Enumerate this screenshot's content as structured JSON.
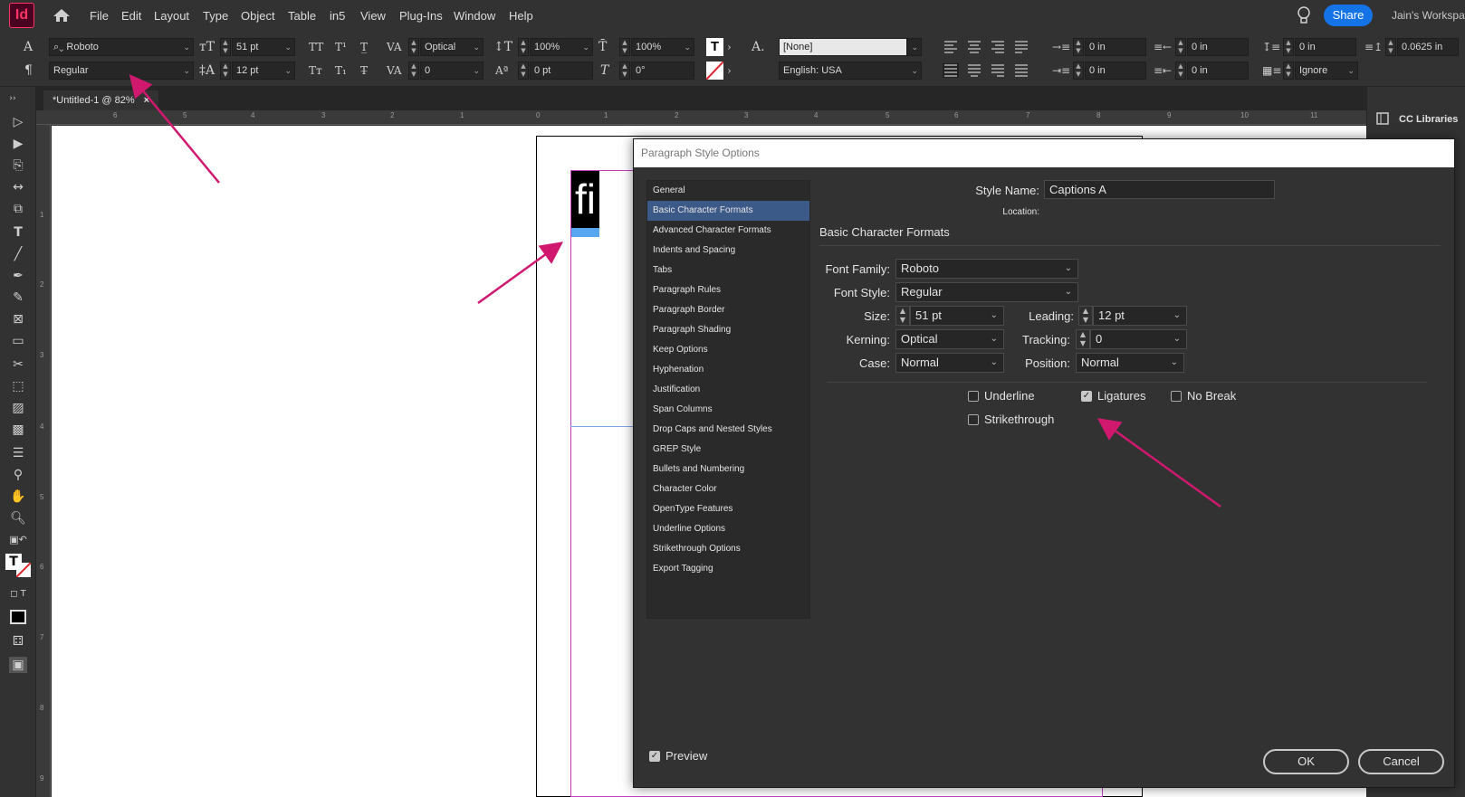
{
  "app": {
    "logo": "Id",
    "colors": {
      "accent": "#1473e6",
      "logo_bg": "#49021f",
      "logo_fg": "#ff3366",
      "annotation_arrow": "#d0186f",
      "selected_category": "#3c5a88"
    }
  },
  "menubar": {
    "items": [
      "File",
      "Edit",
      "Layout",
      "Type",
      "Object",
      "Table",
      "in5",
      "View",
      "Plug-Ins",
      "Window",
      "Help"
    ],
    "share_label": "Share",
    "workspace": "Jain's Workspace"
  },
  "control_panel": {
    "mode_char": "A",
    "mode_para": "¶",
    "font_family": "Roboto",
    "font_style": "Regular",
    "font_size": "51 pt",
    "leading": "12 pt",
    "kerning": "Optical",
    "tracking": "0",
    "vertical_scale": "100%",
    "horizontal_scale": "100%",
    "baseline_shift": "0 pt",
    "skew": "0°",
    "char_style": "[None]",
    "language": "English: USA",
    "left_indent": "0 in",
    "first_line_indent": "0 in",
    "right_indent": "0 in",
    "last_line_indent": "0 in",
    "space_before": "0 in",
    "space_after": "0.0625 in",
    "grid_align": "Ignore"
  },
  "document": {
    "tab_title": "*Untitled-1 @ 82%",
    "close_glyph": "×",
    "glyph_sample": "fi"
  },
  "rulers": {
    "h_ticks": [
      "6",
      "5",
      "4",
      "3",
      "2",
      "1",
      "0",
      "1",
      "2",
      "3",
      "4",
      "5",
      "6",
      "7",
      "8",
      "9",
      "10",
      "11"
    ],
    "v_ticks": [
      "1",
      "2",
      "3",
      "4",
      "5",
      "6",
      "7",
      "8",
      "9"
    ]
  },
  "right_panel": {
    "cc_libraries": "CC Libraries"
  },
  "dialog": {
    "title": "Paragraph Style Options",
    "categories": [
      "General",
      "Basic Character Formats",
      "Advanced Character Formats",
      "Indents and Spacing",
      "Tabs",
      "Paragraph Rules",
      "Paragraph Border",
      "Paragraph Shading",
      "Keep Options",
      "Hyphenation",
      "Justification",
      "Span Columns",
      "Drop Caps and Nested Styles",
      "GREP Style",
      "Bullets and Numbering",
      "Character Color",
      "OpenType Features",
      "Underline Options",
      "Strikethrough Options",
      "Export Tagging"
    ],
    "selected_category": "Basic Character Formats",
    "style_name_label": "Style Name:",
    "style_name": "Captions A",
    "location_label": "Location:",
    "section_title": "Basic Character Formats",
    "font_family_label": "Font Family:",
    "font_family": "Roboto",
    "font_style_label": "Font Style:",
    "font_style": "Regular",
    "size_label": "Size:",
    "size": "51 pt",
    "leading_label": "Leading:",
    "leading": "12 pt",
    "kerning_label": "Kerning:",
    "kerning": "Optical",
    "tracking_label": "Tracking:",
    "tracking": "0",
    "case_label": "Case:",
    "case": "Normal",
    "position_label": "Position:",
    "position": "Normal",
    "underline_label": "Underline",
    "ligatures_label": "Ligatures",
    "no_break_label": "No Break",
    "strikethrough_label": "Strikethrough",
    "preview_label": "Preview",
    "ok_label": "OK",
    "cancel_label": "Cancel"
  }
}
